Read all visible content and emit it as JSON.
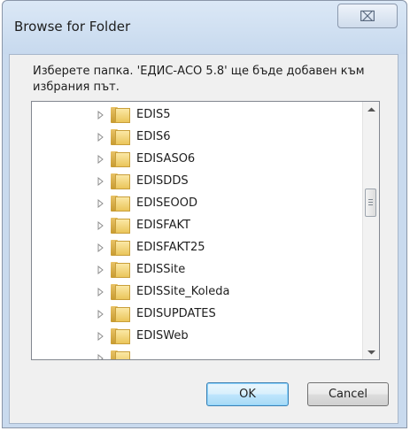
{
  "window": {
    "title": "Browse for Folder",
    "close_symbol": "⌧"
  },
  "prompt": "Изберете папка. 'ЕДИС-АСО 5.8' ще бъде добавен към избрания път.",
  "tree": {
    "items": [
      {
        "label": "EDIS5"
      },
      {
        "label": "EDIS6"
      },
      {
        "label": "EDISASO6"
      },
      {
        "label": "EDISDDS"
      },
      {
        "label": "EDISEOOD"
      },
      {
        "label": "EDISFAKT"
      },
      {
        "label": "EDISFAKT25"
      },
      {
        "label": "EDISSite"
      },
      {
        "label": "EDISSite_Koleda"
      },
      {
        "label": "EDISUPDATES"
      },
      {
        "label": "EDISWeb"
      },
      {
        "label": ""
      }
    ]
  },
  "buttons": {
    "ok": "OK",
    "cancel": "Cancel"
  },
  "colors": {
    "title_bar": "#c7d9ee",
    "folder": "#eac55b",
    "ok_border": "#3c7fb1"
  },
  "icons": {
    "expander": "triangle-right-icon",
    "folder": "folder-icon",
    "close": "close-icon"
  }
}
